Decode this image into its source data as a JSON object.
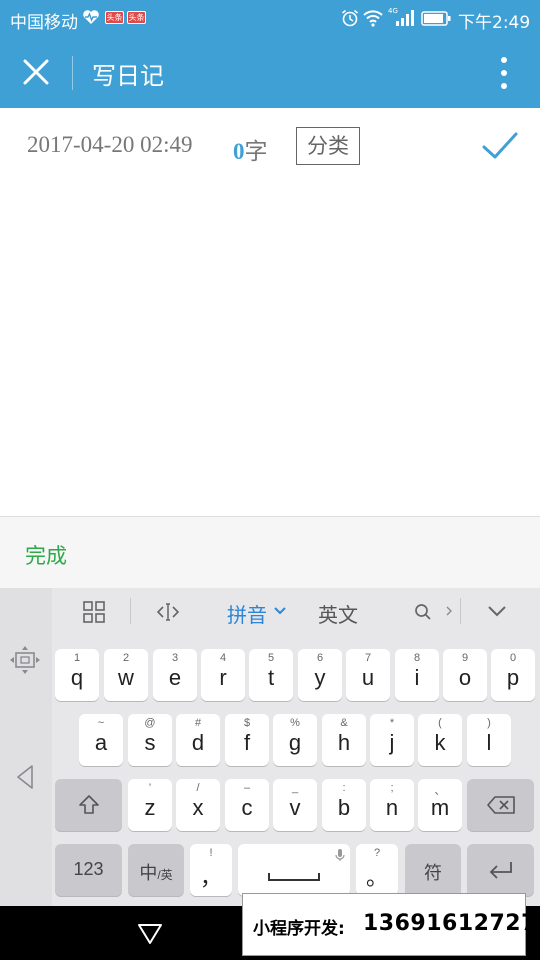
{
  "status_bar": {
    "carrier": "中国移动",
    "badge_1": "头条",
    "badge_2": "头条",
    "network_label": "4G",
    "time": "下午2:49",
    "icons": [
      "heart-pulse-icon",
      "alarm-icon",
      "wifi-icon",
      "signal-icon",
      "battery-icon"
    ]
  },
  "app_bar": {
    "title": "写日记",
    "background_color": "#3fa0d6",
    "icons": [
      "close-icon",
      "more-vertical-icon"
    ]
  },
  "meta": {
    "date": "2017-04-20 02:49",
    "word_count": "0",
    "word_unit": "字",
    "category_label": "分类",
    "accent_color": "#3fa0d6"
  },
  "editor": {
    "content": ""
  },
  "done_bar": {
    "done_label": "完成",
    "done_color": "#2fa84a"
  },
  "keyboard": {
    "toolbar": {
      "pinyin_label": "拼音",
      "english_label": "英文"
    },
    "row1": [
      {
        "main": "q",
        "sub": "1"
      },
      {
        "main": "w",
        "sub": "2"
      },
      {
        "main": "e",
        "sub": "3"
      },
      {
        "main": "r",
        "sub": "4"
      },
      {
        "main": "t",
        "sub": "5"
      },
      {
        "main": "y",
        "sub": "6"
      },
      {
        "main": "u",
        "sub": "7"
      },
      {
        "main": "i",
        "sub": "8"
      },
      {
        "main": "o",
        "sub": "9"
      },
      {
        "main": "p",
        "sub": "0"
      }
    ],
    "row2": [
      {
        "main": "a",
        "sub": "~"
      },
      {
        "main": "s",
        "sub": "@"
      },
      {
        "main": "d",
        "sub": "#"
      },
      {
        "main": "f",
        "sub": "$"
      },
      {
        "main": "g",
        "sub": "%"
      },
      {
        "main": "h",
        "sub": "&"
      },
      {
        "main": "j",
        "sub": "*"
      },
      {
        "main": "k",
        "sub": "("
      },
      {
        "main": "l",
        "sub": ")"
      }
    ],
    "row3": [
      {
        "main": "z",
        "sub": "’"
      },
      {
        "main": "x",
        "sub": "/"
      },
      {
        "main": "c",
        "sub": "–"
      },
      {
        "main": "v",
        "sub": "_"
      },
      {
        "main": "b",
        "sub": ":"
      },
      {
        "main": "n",
        "sub": ";"
      },
      {
        "main": "m",
        "sub": "、"
      }
    ],
    "row4": {
      "numbers_label": "123",
      "lang_main": "中",
      "lang_sub": "/英",
      "comma_main": "，",
      "comma_sub": "!",
      "period_main": "。",
      "period_sub": "?",
      "symbol_label": "符"
    }
  },
  "watermark": {
    "label": "小程序开发:",
    "phone": "13691612727"
  }
}
